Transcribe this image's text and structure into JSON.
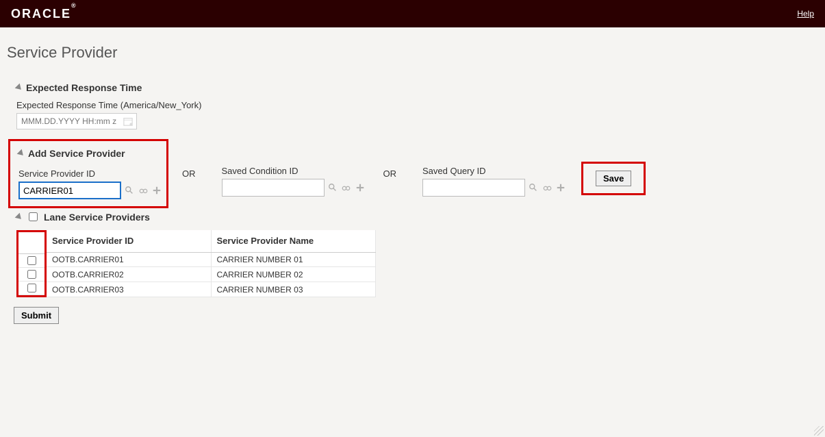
{
  "header": {
    "logo_text": "ORACLE",
    "help_label": "Help"
  },
  "page": {
    "title": "Service Provider"
  },
  "expected_response": {
    "section_title": "Expected Response Time",
    "field_label": "Expected Response Time (America/New_York)",
    "placeholder": "MMM.DD.YYYY HH:mm z"
  },
  "add_service_provider": {
    "section_title": "Add Service Provider",
    "field1_label": "Service Provider ID",
    "field1_value": "CARRIER01",
    "or_label": "OR",
    "field2_label": "Saved Condition ID",
    "field2_value": "",
    "field3_label": "Saved Query ID",
    "field3_value": "",
    "save_label": "Save"
  },
  "lane_table": {
    "section_title": "Lane Service Providers",
    "col1": "Service Provider ID",
    "col2": "Service Provider Name",
    "rows": [
      {
        "id": "OOTB.CARRIER01",
        "name": "CARRIER NUMBER 01"
      },
      {
        "id": "OOTB.CARRIER02",
        "name": "CARRIER NUMBER 02"
      },
      {
        "id": "OOTB.CARRIER03",
        "name": "CARRIER NUMBER 03"
      }
    ]
  },
  "submit_label": "Submit"
}
